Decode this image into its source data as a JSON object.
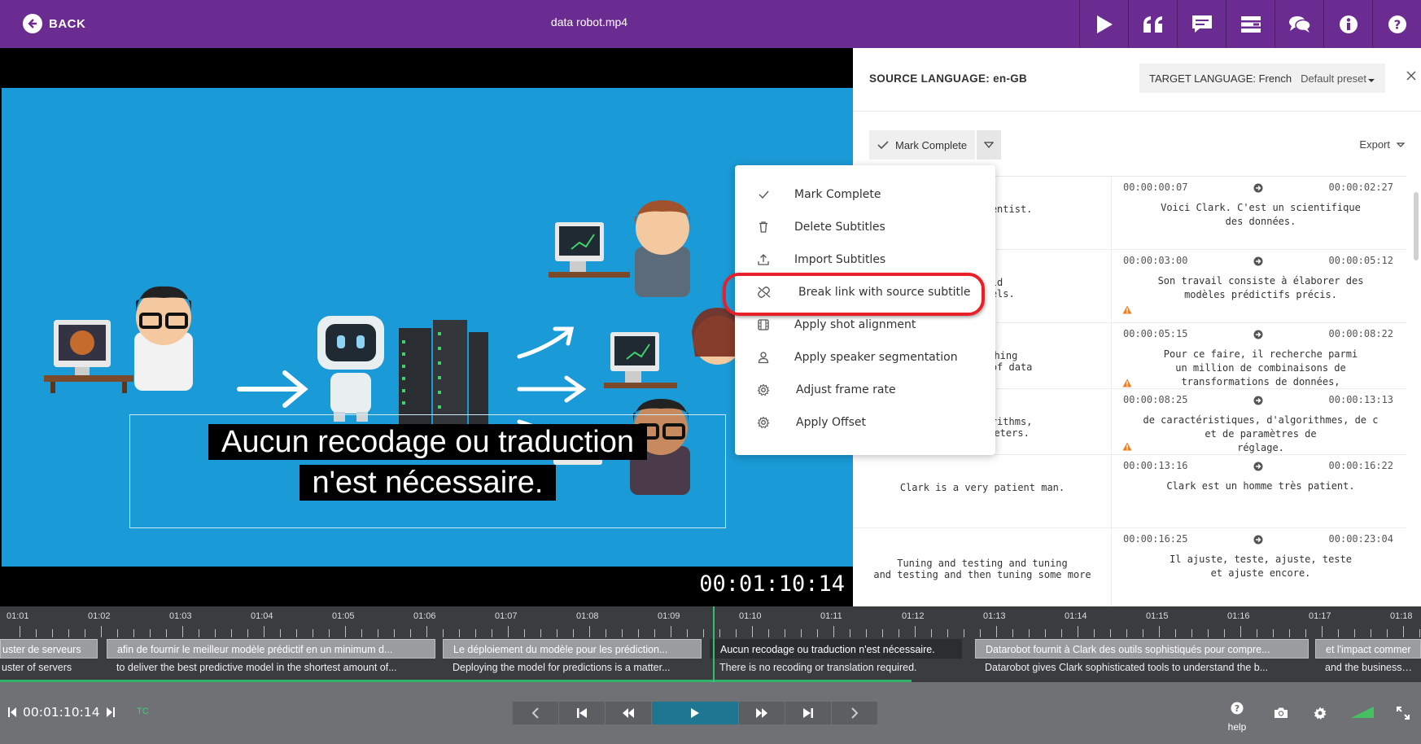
{
  "topbar": {
    "back_label": "BACK",
    "file_title": "data robot.mp4",
    "icons": [
      "play-icon",
      "quote-icon",
      "caption-icon",
      "lines-icon",
      "chat-icon",
      "info-icon",
      "help-icon"
    ]
  },
  "video": {
    "subtitle_line1": "Aucun recodage ou traduction",
    "subtitle_line2": "n'est nécessaire.",
    "timecode": "00:01:10:14"
  },
  "panel": {
    "source_language": "SOURCE LANGUAGE: en-GB",
    "target_language": "TARGET LANGUAGE: French",
    "preset": "Default preset",
    "mark_complete": "Mark Complete",
    "export": "Export"
  },
  "menu": {
    "items": [
      {
        "label": "Mark Complete",
        "icon": "check-icon"
      },
      {
        "label": "Delete Subtitles",
        "icon": "trash-icon"
      },
      {
        "label": "Import Subtitles",
        "icon": "upload-icon"
      },
      {
        "label": "Break link with source subtitle",
        "icon": "unlink-icon"
      },
      {
        "label": "Apply shot alignment",
        "icon": "film-icon"
      },
      {
        "label": "Apply speaker segmentation",
        "icon": "person-icon"
      },
      {
        "label": "Adjust frame rate",
        "icon": "gear-icon"
      },
      {
        "label": "Apply Offset",
        "icon": "gear-icon"
      }
    ]
  },
  "subtitles": [
    {
      "src": "a data scientist.",
      "tin": "00:00:00:07",
      "tout": "00:00:02:27",
      "tgt": "Voici Clark. C'est un scientifique\ndes données.",
      "warn": false
    },
    {
      "src": "o build\nive models.",
      "tin": "00:00:03:00",
      "tout": "00:00:05:12",
      "tgt": "Son travail consiste à élaborer des\nmodèles prédictifs précis.",
      "warn": true
    },
    {
      "src": "by searching\nbinations of data",
      "tin": "00:00:05:15",
      "tout": "00:00:08:22",
      "tgt": "Pour ce faire, il recherche parmi\nun million de combinaisons de\ntransformations de données,",
      "warn": true
    },
    {
      "src": "ures, algorithms,\nning parameters.",
      "tin": "00:00:08:25",
      "tout": "00:00:13:13",
      "tgt": "de caractéristiques, d'algorithmes, de c\net de paramètres de\nréglage.",
      "warn": true
    },
    {
      "src": "Clark is a very patient man.",
      "tin": "00:00:13:16",
      "tout": "00:00:16:22",
      "tgt": "Clark est un homme très patient.",
      "warn": false
    },
    {
      "src": "Tuning and testing and tuning\nand testing and then tuning some more",
      "tin": "00:00:16:25",
      "tout": "00:00:23:04",
      "tgt": "Il ajuste, teste, ajuste, teste\net ajuste encore.",
      "warn": false
    }
  ],
  "timeline": {
    "ticks": [
      "01:01",
      "01:02",
      "01:03",
      "01:04",
      "01:05",
      "01:06",
      "01:07",
      "01:08",
      "01:09",
      "01:10",
      "01:11",
      "01:12",
      "01:13",
      "01:14",
      "01:15",
      "01:16",
      "01:17",
      "01:18"
    ],
    "track1": [
      "uster de serveurs",
      "afin de fournir le meilleur modèle prédictif en un minimum d...",
      "Le déploiement du modèle pour les prédiction...",
      "Aucun recodage ou traduction n'est nécessaire.",
      "Datarobot fournit à Clark des outils sophistiqués pour compre...",
      "et l'impact commer"
    ],
    "track2": [
      "uster of servers",
      "to deliver the best predictive model in the shortest amount of...",
      "Deploying the model for predictions is a matter...",
      "There is no recoding or translation required.",
      "Datarobot gives Clark sophisticated tools to understand the b...",
      "and the business im"
    ]
  },
  "controls": {
    "timecode": "00:01:10:14",
    "tc_badge": "TC",
    "help_label": "help"
  }
}
